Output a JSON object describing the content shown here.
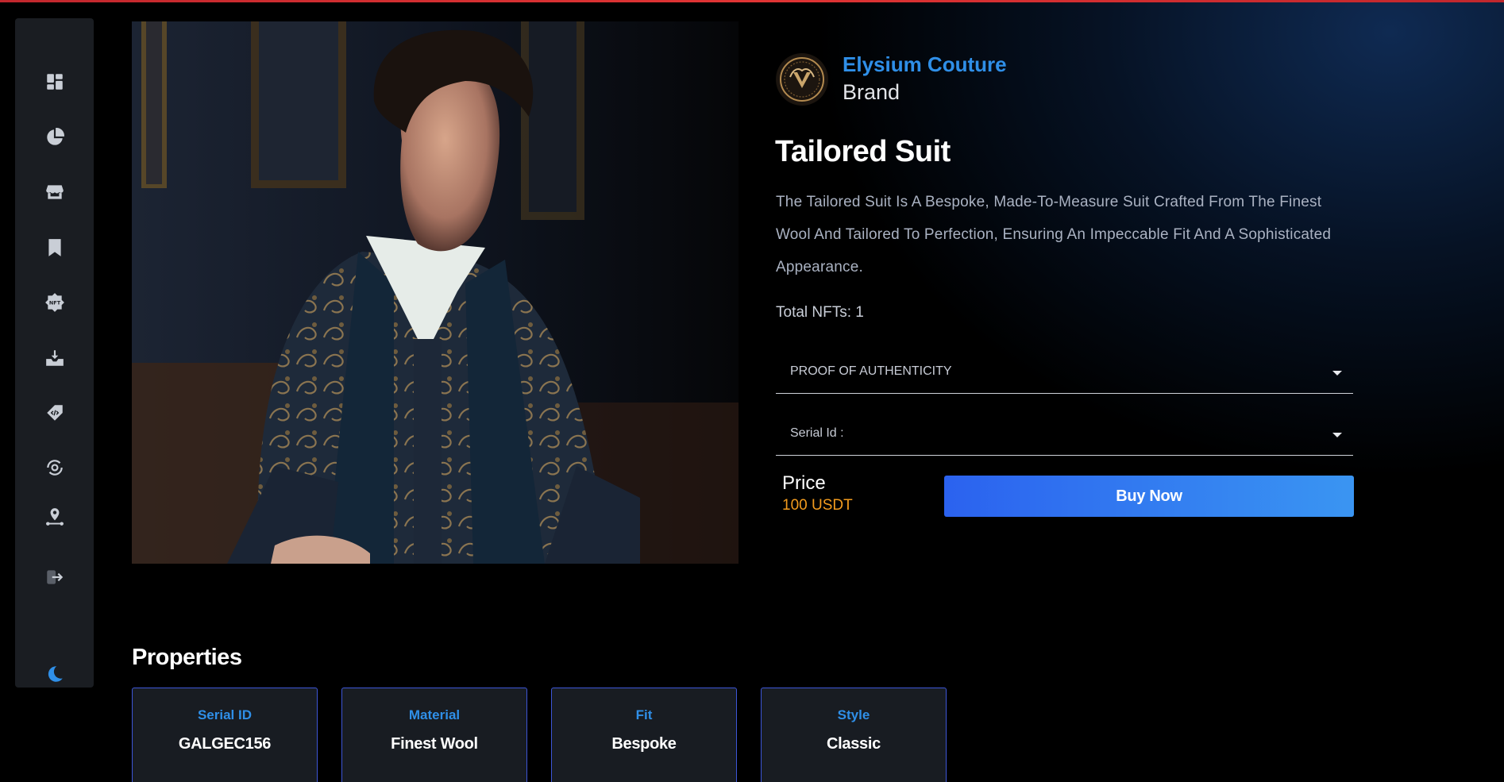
{
  "sidebar": {
    "items": [
      {
        "icon": "dashboard-icon"
      },
      {
        "icon": "pie-chart-icon"
      },
      {
        "icon": "store-icon"
      },
      {
        "icon": "bookmark-icon"
      },
      {
        "icon": "nft-icon"
      },
      {
        "icon": "inbox-download-icon"
      },
      {
        "icon": "code-tag-icon"
      },
      {
        "icon": "settings-sync-icon"
      },
      {
        "icon": "location-network-icon"
      },
      {
        "icon": "logout-icon"
      }
    ],
    "theme_toggle_icon": "moon-icon"
  },
  "colors": {
    "accent": "#2f8fe8",
    "button_gradient_start": "#2b62ef",
    "button_gradient_end": "#3a95f2",
    "price": "#f29b1e",
    "card_border": "#3d56d8",
    "top_bar": "#c1272d"
  },
  "brand": {
    "name": "Elysium Couture",
    "label": "Brand"
  },
  "product": {
    "title": "Tailored Suit",
    "description": "The Tailored Suit Is A Bespoke, Made-To-Measure Suit Crafted From The Finest Wool And Tailored To Perfection, Ensuring An Impeccable Fit And A Sophisticated Appearance.",
    "total_nfts": "Total NFTs: 1"
  },
  "dropdowns": {
    "proof": "PROOF OF AUTHENTICITY",
    "serial": "Serial Id :"
  },
  "price": {
    "label": "Price",
    "value": "100 USDT"
  },
  "buy_button": "Buy Now",
  "properties": {
    "title": "Properties",
    "items": [
      {
        "name": "Serial ID",
        "value": "GALGEC156"
      },
      {
        "name": "Material",
        "value": "Finest Wool"
      },
      {
        "name": "Fit",
        "value": "Bespoke"
      },
      {
        "name": "Style",
        "value": "Classic"
      }
    ]
  }
}
